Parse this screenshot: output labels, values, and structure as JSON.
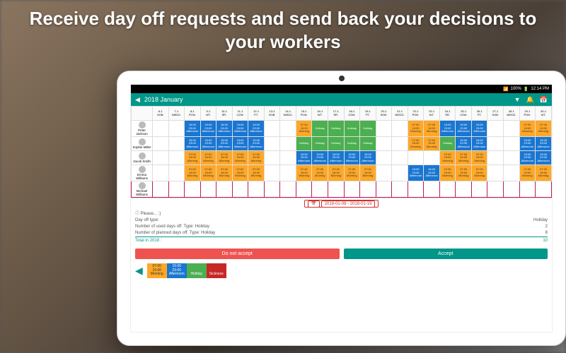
{
  "headline": "Receive day off requests and send back your decisions to your workers",
  "statusbar": {
    "signal": "📶",
    "wifi": "100%",
    "battery": "🔋",
    "time": "12:14 PM"
  },
  "appbar": {
    "back": "◀",
    "title": "2018 January",
    "dropdown": "▼",
    "bell": "🔔",
    "cal": "📅"
  },
  "days": [
    {
      "d": "6-1",
      "w": "SOB."
    },
    {
      "d": "7-1",
      "w": "NIEDZ."
    },
    {
      "d": "8-1",
      "w": "PON."
    },
    {
      "d": "9-1",
      "w": "WT."
    },
    {
      "d": "10-1",
      "w": "ŚR."
    },
    {
      "d": "11-1",
      "w": "CZW."
    },
    {
      "d": "12-1",
      "w": "PT."
    },
    {
      "d": "13-1",
      "w": "SOB."
    },
    {
      "d": "14-1",
      "w": "NIEDZ."
    },
    {
      "d": "15-1",
      "w": "PON."
    },
    {
      "d": "16-1",
      "w": "WT."
    },
    {
      "d": "17-1",
      "w": "ŚR."
    },
    {
      "d": "18-1",
      "w": "CZW."
    },
    {
      "d": "19-1",
      "w": "PT."
    },
    {
      "d": "20-1",
      "w": "SOB."
    },
    {
      "d": "21-1",
      "w": "NIEDZ."
    },
    {
      "d": "22-1",
      "w": "PON."
    },
    {
      "d": "23-1",
      "w": "WT."
    },
    {
      "d": "24-1",
      "w": "ŚR."
    },
    {
      "d": "25-1",
      "w": "CZW."
    },
    {
      "d": "26-1",
      "w": "PT."
    },
    {
      "d": "27-1",
      "w": "SOB."
    },
    {
      "d": "28-1",
      "w": "NIEDZ."
    },
    {
      "d": "29-1",
      "w": "PON."
    },
    {
      "d": "30-1",
      "w": "WT."
    }
  ],
  "employees": [
    {
      "name": "Peter Jackson",
      "shifts": [
        "",
        "",
        "A",
        "A",
        "A",
        "A",
        "A",
        "",
        "",
        "M",
        "H",
        "H",
        "H",
        "H",
        "",
        "",
        "M",
        "M",
        "A",
        "A",
        "A",
        "",
        "",
        "M",
        "M"
      ]
    },
    {
      "name": "Sophie Miller",
      "shifts": [
        "",
        "",
        "A",
        "A",
        "A",
        "A",
        "A",
        "",
        "",
        "H",
        "H",
        "H",
        "H",
        "H",
        "",
        "",
        "M",
        "M",
        "H",
        "A",
        "A",
        "",
        "",
        "A",
        "A"
      ]
    },
    {
      "name": "Jacob Smith",
      "shifts": [
        "",
        "",
        "M",
        "M",
        "M",
        "M",
        "M",
        "",
        "",
        "A",
        "A",
        "A",
        "A",
        "A",
        "",
        "",
        "",
        "",
        "M",
        "M",
        "M",
        "",
        "",
        "A",
        "A"
      ]
    },
    {
      "name": "Emma Williams",
      "shifts": [
        "",
        "",
        "M",
        "M",
        "M",
        "M",
        "M",
        "",
        "",
        "M",
        "M",
        "M",
        "M",
        "M",
        "",
        "",
        "A",
        "A",
        "M",
        "M",
        "M",
        "",
        "",
        "M",
        "M"
      ]
    },
    {
      "name": "Michael Williams",
      "shifts": [
        "",
        "",
        "",
        "",
        "",
        "",
        "",
        "",
        "",
        "",
        "",
        "",
        "",
        "",
        "",
        "",
        "",
        "",
        "",
        "",
        "",
        "",
        "",
        "",
        ""
      ]
    }
  ],
  "shiftTypes": {
    "M": {
      "cls": "morning",
      "label": "Morning",
      "t1": "07:00",
      "t2": "15:00"
    },
    "A": {
      "cls": "afternoon",
      "label": "Afternoon",
      "t1": "15:00",
      "t2": "23:00"
    },
    "H": {
      "cls": "holiday",
      "label": "Holiday",
      "t1": "",
      "t2": ""
    },
    "S": {
      "cls": "sickness",
      "label": "Sickness",
      "t1": "",
      "t2": ""
    }
  },
  "daterange": {
    "icon": "📅",
    "text": "2018-01-08 - 2018-01-19"
  },
  "info": {
    "please": "ⓘ Please... :)",
    "type_label": "Day off type:",
    "type_value": "Holiday",
    "used_label": "Number of used days off. Type: Holiday",
    "used_value": "2",
    "planned_label": "Number of planned days off. Type: Holiday",
    "planned_value": "8",
    "total_label": "Total in 2018 :",
    "total_value": "10"
  },
  "actions": {
    "reject": "Do not accept",
    "accept": "Accept"
  },
  "legend": [
    {
      "k": "M",
      "t1": "07:00",
      "t2": "15:00",
      "label": "Morning"
    },
    {
      "k": "A",
      "t1": "15:00",
      "t2": "23:00",
      "label": "Afternoon"
    },
    {
      "k": "H",
      "t1": "",
      "t2": "",
      "label": "Holiday"
    },
    {
      "k": "S",
      "t1": "",
      "t2": "",
      "label": "Sickness"
    }
  ]
}
